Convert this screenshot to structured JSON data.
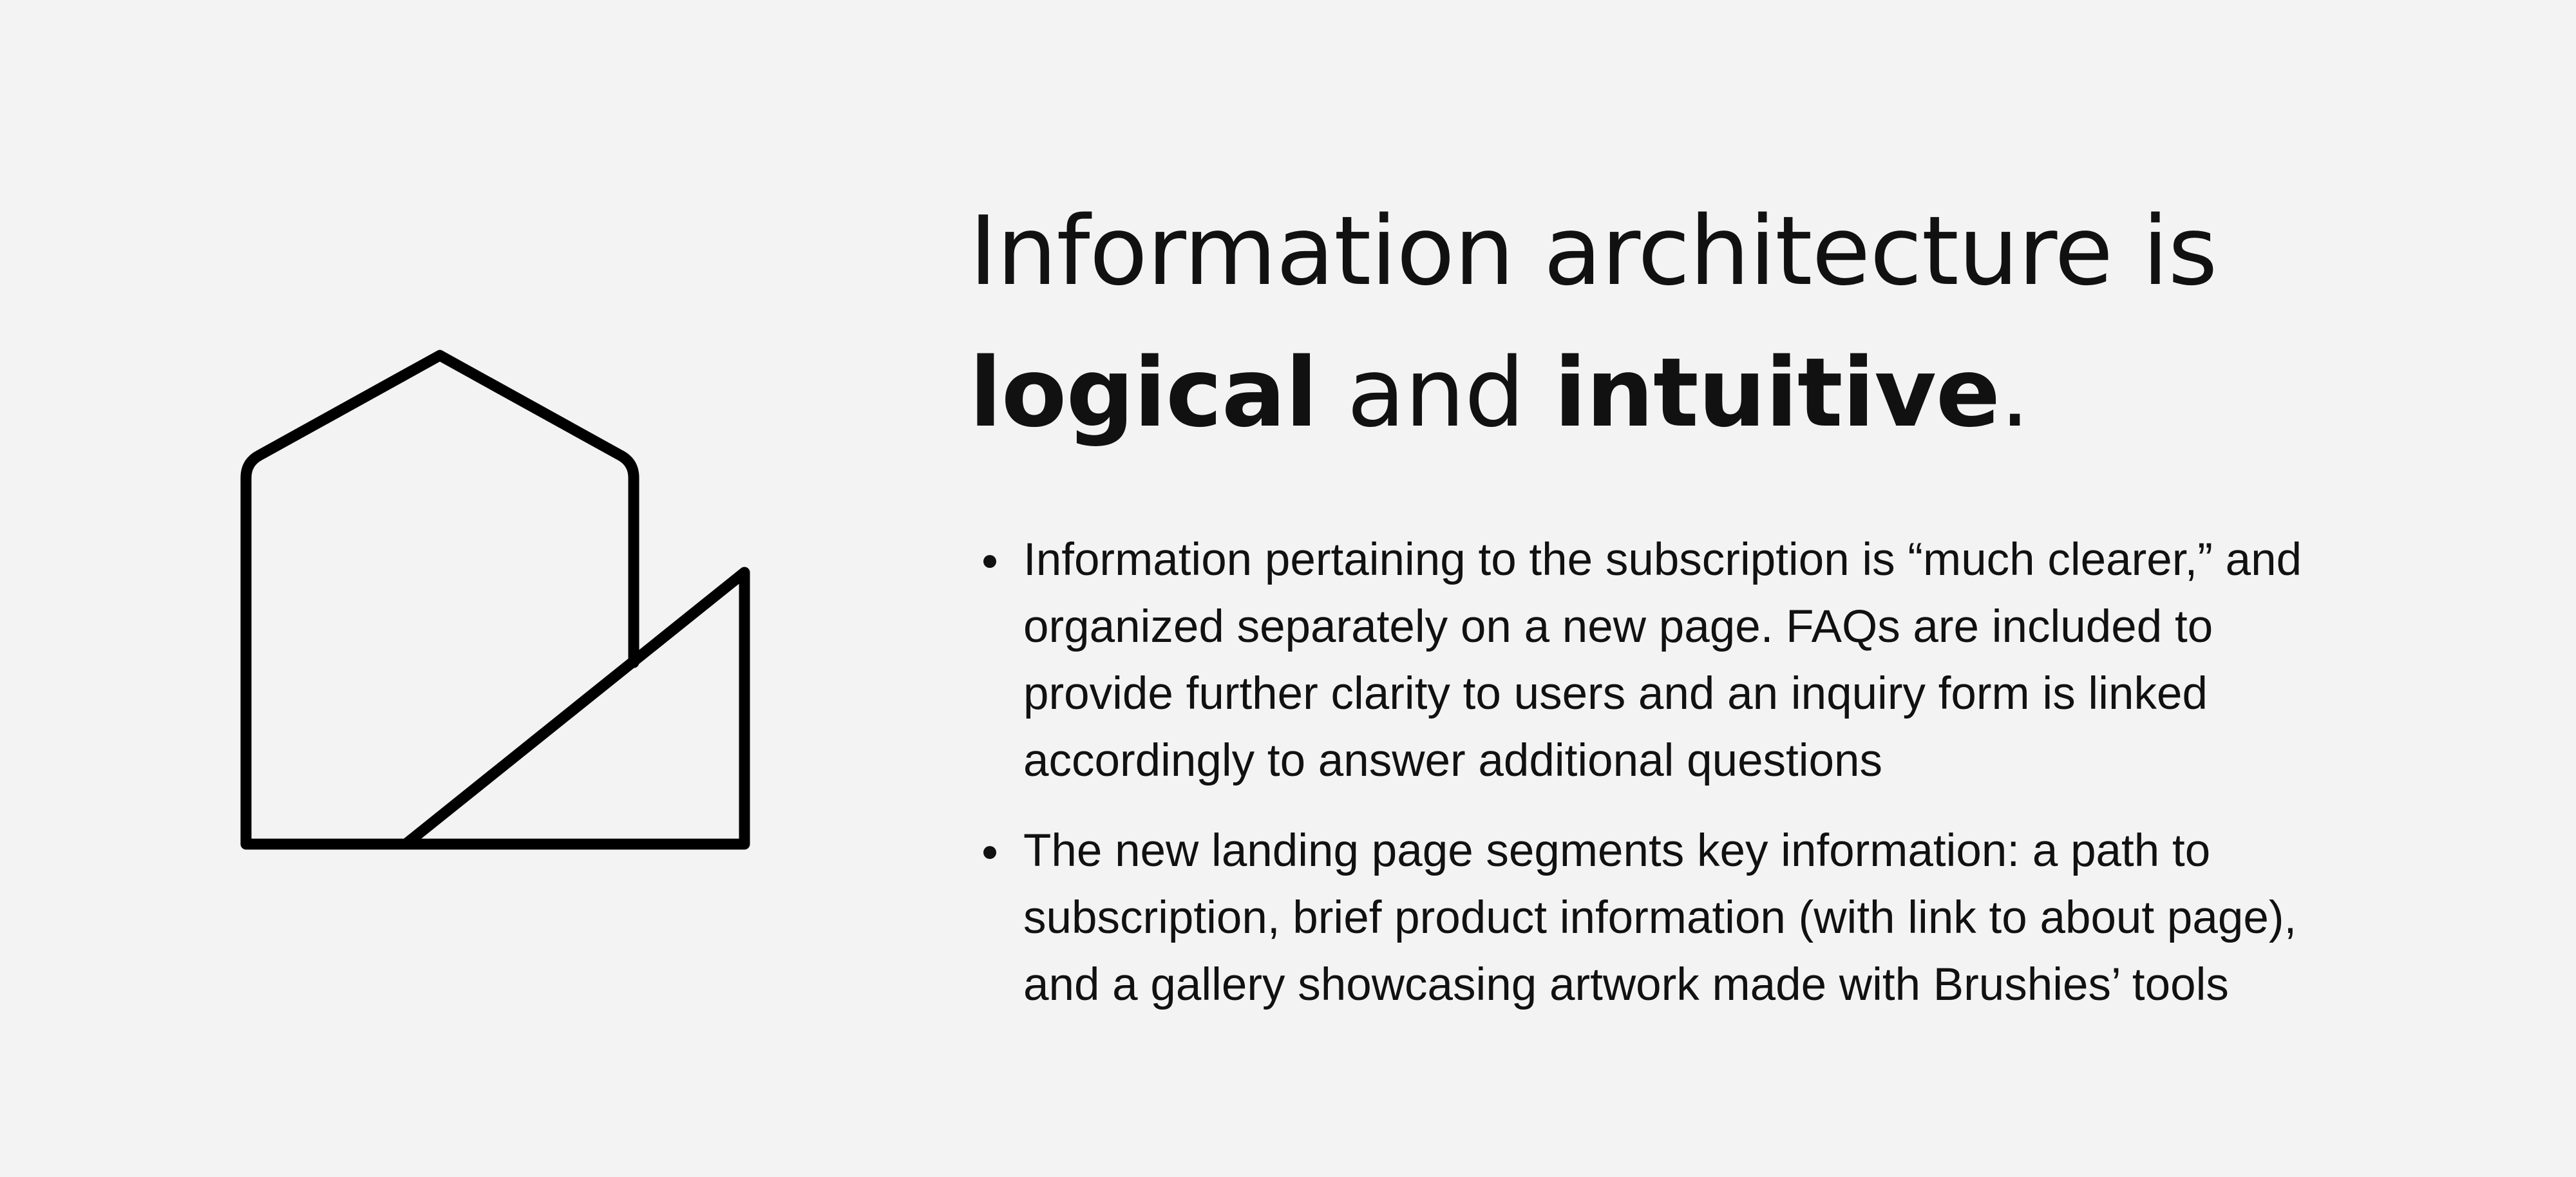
{
  "logo": {
    "icon": "house-with-triangle-logo",
    "color": "#000000"
  },
  "headline": {
    "line1": "Information architecture is",
    "bold1": "logical",
    "middle": " and ",
    "bold2": "intuitive",
    "end": "."
  },
  "bullets": [
    "Information pertaining to the subscription is “much clearer,” and organized separately on a new page. FAQs are included to provide further clarity to users and an inquiry form is linked accordingly to answer additional questions",
    "The new landing page segments key information: a path to subscription, brief product information (with link to about page), and a gallery showcasing artwork made with Brushies’ tools"
  ],
  "colors": {
    "background": "#f3f3f3",
    "text": "#111111"
  }
}
